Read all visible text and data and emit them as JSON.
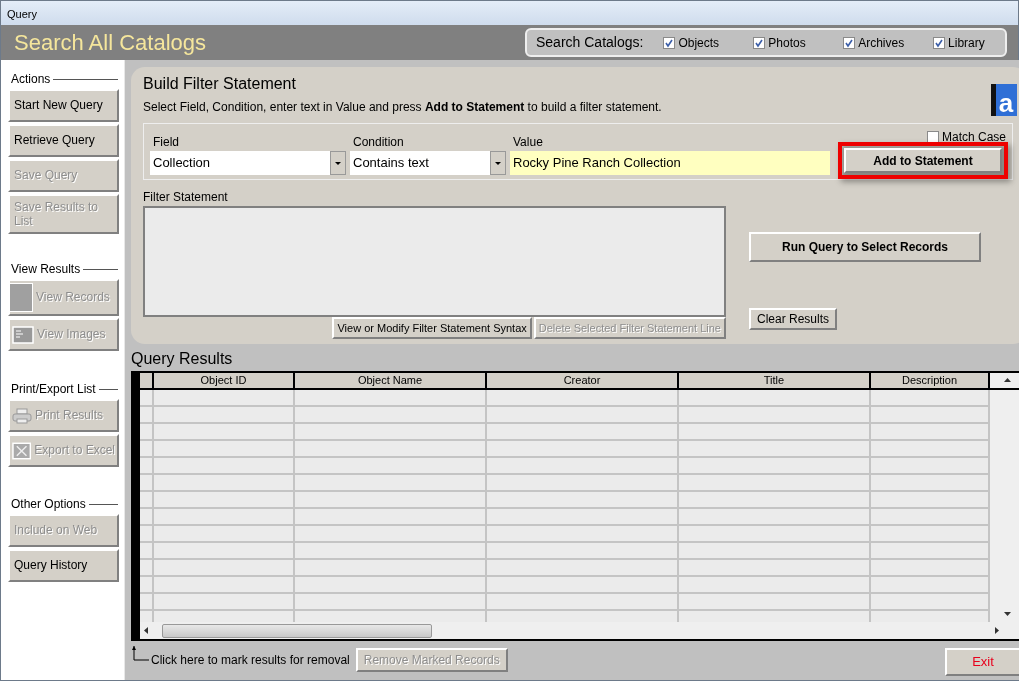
{
  "window": {
    "title": "Query"
  },
  "header": {
    "title": "Search All Catalogs",
    "catalogs_label": "Search Catalogs:",
    "catalogs": [
      {
        "label": "Objects",
        "checked": true
      },
      {
        "label": "Photos",
        "checked": true
      },
      {
        "label": "Archives",
        "checked": true
      },
      {
        "label": "Library",
        "checked": true
      }
    ]
  },
  "sidebar": {
    "sections": [
      {
        "title": "Actions",
        "buttons": [
          {
            "label": "Start New Query",
            "disabled": false,
            "kind": "plain"
          },
          {
            "label": "Retrieve Query",
            "disabled": false,
            "kind": "plain"
          },
          {
            "label": "Save Query",
            "disabled": true,
            "kind": "plain"
          },
          {
            "label": "Save Results to List",
            "disabled": true,
            "kind": "plain"
          }
        ]
      },
      {
        "title": "View Results",
        "buttons": [
          {
            "label": "View Records",
            "disabled": true,
            "kind": "swatch"
          },
          {
            "label": "View Images",
            "disabled": true,
            "kind": "image"
          }
        ]
      },
      {
        "title": "Print/Export List",
        "buttons": [
          {
            "label": "Print Results",
            "disabled": true,
            "kind": "print"
          },
          {
            "label": "Export to Excel",
            "disabled": true,
            "kind": "sheet"
          }
        ]
      },
      {
        "title": "Other Options",
        "buttons": [
          {
            "label": "Include on Web",
            "disabled": true,
            "kind": "plain"
          },
          {
            "label": "Query History",
            "disabled": false,
            "kind": "plain"
          }
        ]
      }
    ]
  },
  "build": {
    "title": "Build Filter Statement",
    "instruction": "Select Field, Condition, enter text in Value and press **Add to Statement** to build a filter statement.",
    "logo_text": "a",
    "field": {
      "label": "Field",
      "value": "Collection"
    },
    "condition": {
      "label": "Condition",
      "value": "Contains text"
    },
    "value": {
      "label": "Value",
      "value": "Rocky Pine Ranch Collection"
    },
    "match_case": {
      "label": "Match Case",
      "checked": false
    },
    "add_button": {
      "label": "Add to Statement",
      "highlighted": true
    },
    "filter_label": "Filter Statement",
    "filter_buttons": [
      {
        "label": "View or Modify Filter Statement Syntax",
        "disabled": false
      },
      {
        "label": "Delete Selected Filter Statement Line",
        "disabled": true
      }
    ],
    "run_button": "Run Query to Select Records",
    "clear_button": "Clear Results"
  },
  "results": {
    "title": "Query Results",
    "columns": [
      "Object ID",
      "Object Name",
      "Creator",
      "Title",
      "Description"
    ]
  },
  "footer": {
    "hint": "Click here to mark results for removal",
    "remove_button": {
      "label": "Remove Marked Records",
      "disabled": true
    },
    "exit_button": "Exit"
  }
}
